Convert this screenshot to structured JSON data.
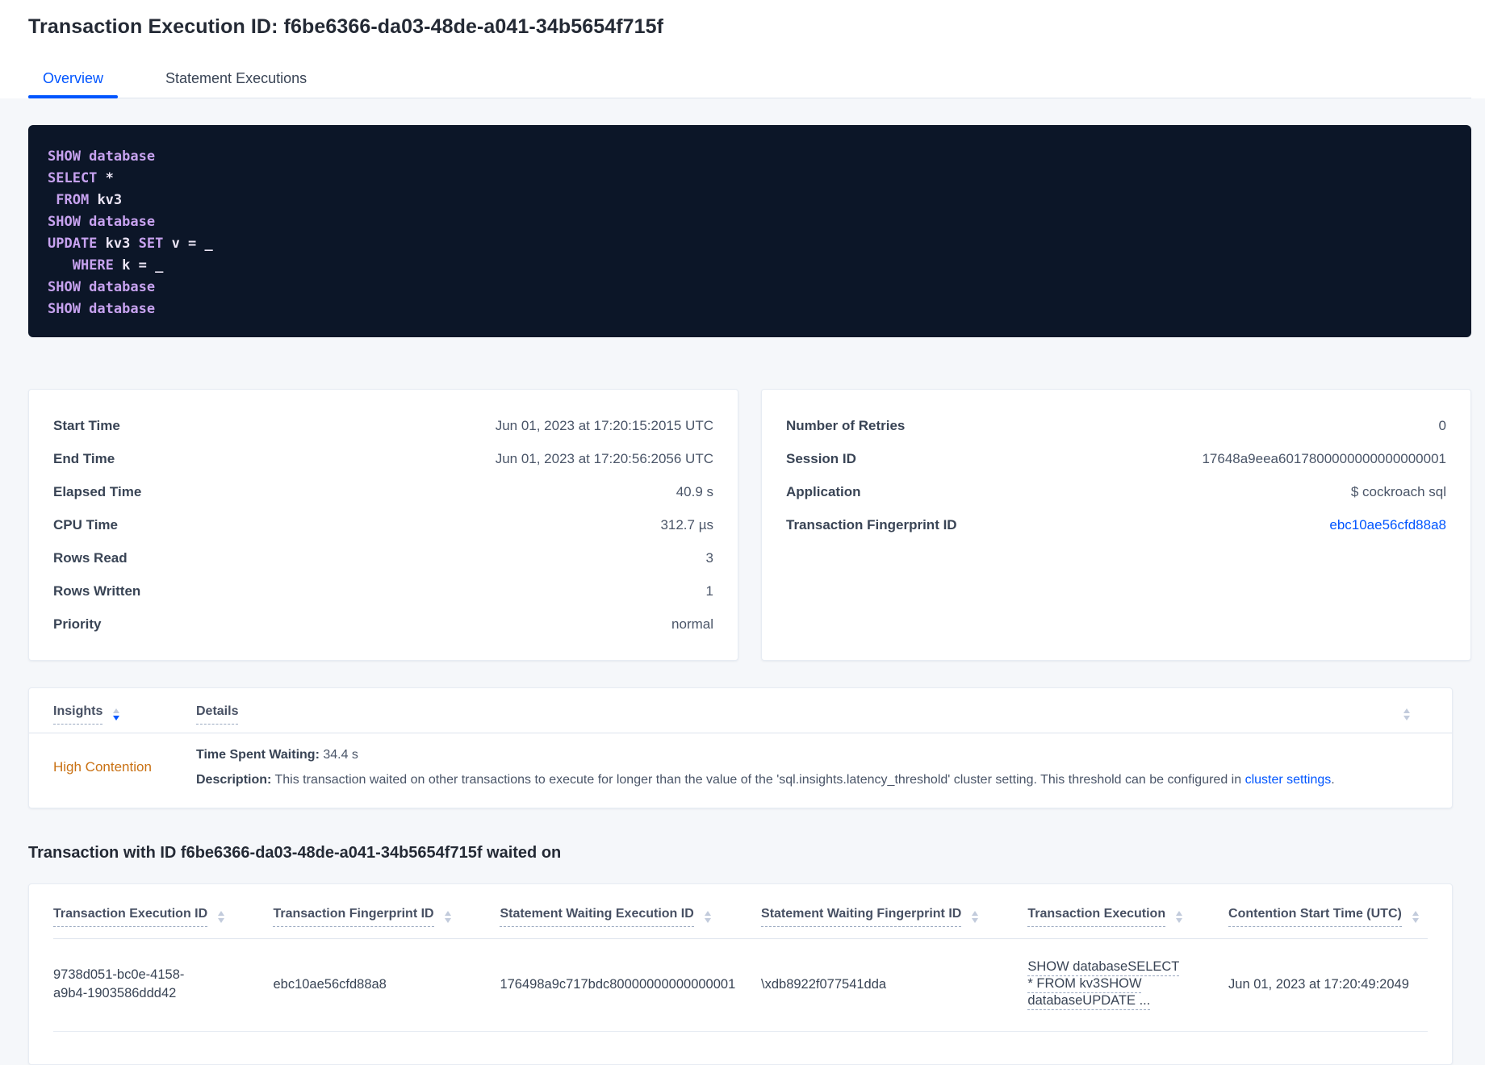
{
  "header": {
    "title": "Transaction Execution ID: f6be6366-da03-48de-a041-34b5654f715f",
    "tabs": [
      {
        "label": "Overview",
        "active": true
      },
      {
        "label": "Statement Executions",
        "active": false
      }
    ]
  },
  "sql": {
    "lines": [
      {
        "segments": [
          {
            "type": "kw",
            "text": "SHOW database"
          }
        ]
      },
      {
        "segments": [
          {
            "type": "kw",
            "text": "SELECT "
          },
          {
            "type": "txt",
            "text": "*"
          }
        ]
      },
      {
        "segments": [
          {
            "type": "txt",
            "text": " "
          },
          {
            "type": "kw",
            "text": "FROM "
          },
          {
            "type": "txt",
            "text": "kv3"
          }
        ]
      },
      {
        "segments": [
          {
            "type": "kw",
            "text": "SHOW database"
          }
        ]
      },
      {
        "segments": [
          {
            "type": "kw",
            "text": "UPDATE "
          },
          {
            "type": "txt",
            "text": "kv3 "
          },
          {
            "type": "kw",
            "text": "SET "
          },
          {
            "type": "txt",
            "text": "v = _"
          }
        ]
      },
      {
        "segments": [
          {
            "type": "txt",
            "text": "   "
          },
          {
            "type": "kw",
            "text": "WHERE "
          },
          {
            "type": "txt",
            "text": "k = _"
          }
        ]
      },
      {
        "segments": [
          {
            "type": "kw",
            "text": "SHOW database"
          }
        ]
      },
      {
        "segments": [
          {
            "type": "kw",
            "text": "SHOW database"
          }
        ]
      }
    ]
  },
  "summary_left": {
    "rows": [
      {
        "label": "Start Time",
        "value": "Jun 01, 2023 at 17:20:15:2015 UTC"
      },
      {
        "label": "End Time",
        "value": "Jun 01, 2023 at 17:20:56:2056 UTC"
      },
      {
        "label": "Elapsed Time",
        "value": "40.9 s"
      },
      {
        "label": "CPU Time",
        "value": "312.7 µs"
      },
      {
        "label": "Rows Read",
        "value": "3"
      },
      {
        "label": "Rows Written",
        "value": "1"
      },
      {
        "label": "Priority",
        "value": "normal"
      }
    ]
  },
  "summary_right": {
    "rows": [
      {
        "label": "Number of Retries",
        "value": "0"
      },
      {
        "label": "Session ID",
        "value": "17648a9eea6017800000000000000001"
      },
      {
        "label": "Application",
        "value": "$ cockroach sql"
      },
      {
        "label": "Transaction Fingerprint ID",
        "value": "ebc10ae56cfd88a8"
      }
    ]
  },
  "insights": {
    "columns": {
      "insights": "Insights",
      "details": "Details"
    },
    "sort_icon": "sort-arrows",
    "row": {
      "insight": "High Contention",
      "waiting_label": "Time Spent Waiting:",
      "waiting_value": " 34.4 s",
      "description_label": "Description:",
      "description_text": " This transaction waited on other transactions to execute for longer than the value of the 'sql.insights.latency_threshold' cluster setting. This threshold can be configured in ",
      "description_link": "cluster settings",
      "description_suffix": "."
    }
  },
  "waited_on": {
    "heading": "Transaction with ID f6be6366-da03-48de-a041-34b5654f715f waited on",
    "columns": [
      "Transaction Execution ID",
      "Transaction Fingerprint ID",
      "Statement Waiting Execution ID",
      "Statement Waiting Fingerprint ID",
      "Transaction Execution",
      "Contention Start Time (UTC)"
    ],
    "rows": [
      {
        "transaction_execution_id": "9738d051-bc0e-4158-a9b4-1903586ddd42",
        "transaction_fingerprint_id": "ebc10ae56cfd88a8",
        "statement_waiting_execution_id": "176498a9c717bdc80000000000000001",
        "statement_waiting_fingerprint_id": "\\xdb8922f077541dda",
        "transaction_execution": "SHOW databaseSELECT * FROM kv3SHOW databaseUPDATE ...",
        "contention_start_time": "Jun 01, 2023 at 17:20:49:2049"
      }
    ]
  },
  "colors": {
    "accent": "#0055ff",
    "insight_warning": "#c97113",
    "code_bg": "#0c1628",
    "code_keyword": "#c7a2ef",
    "code_text": "#ece6f6"
  }
}
